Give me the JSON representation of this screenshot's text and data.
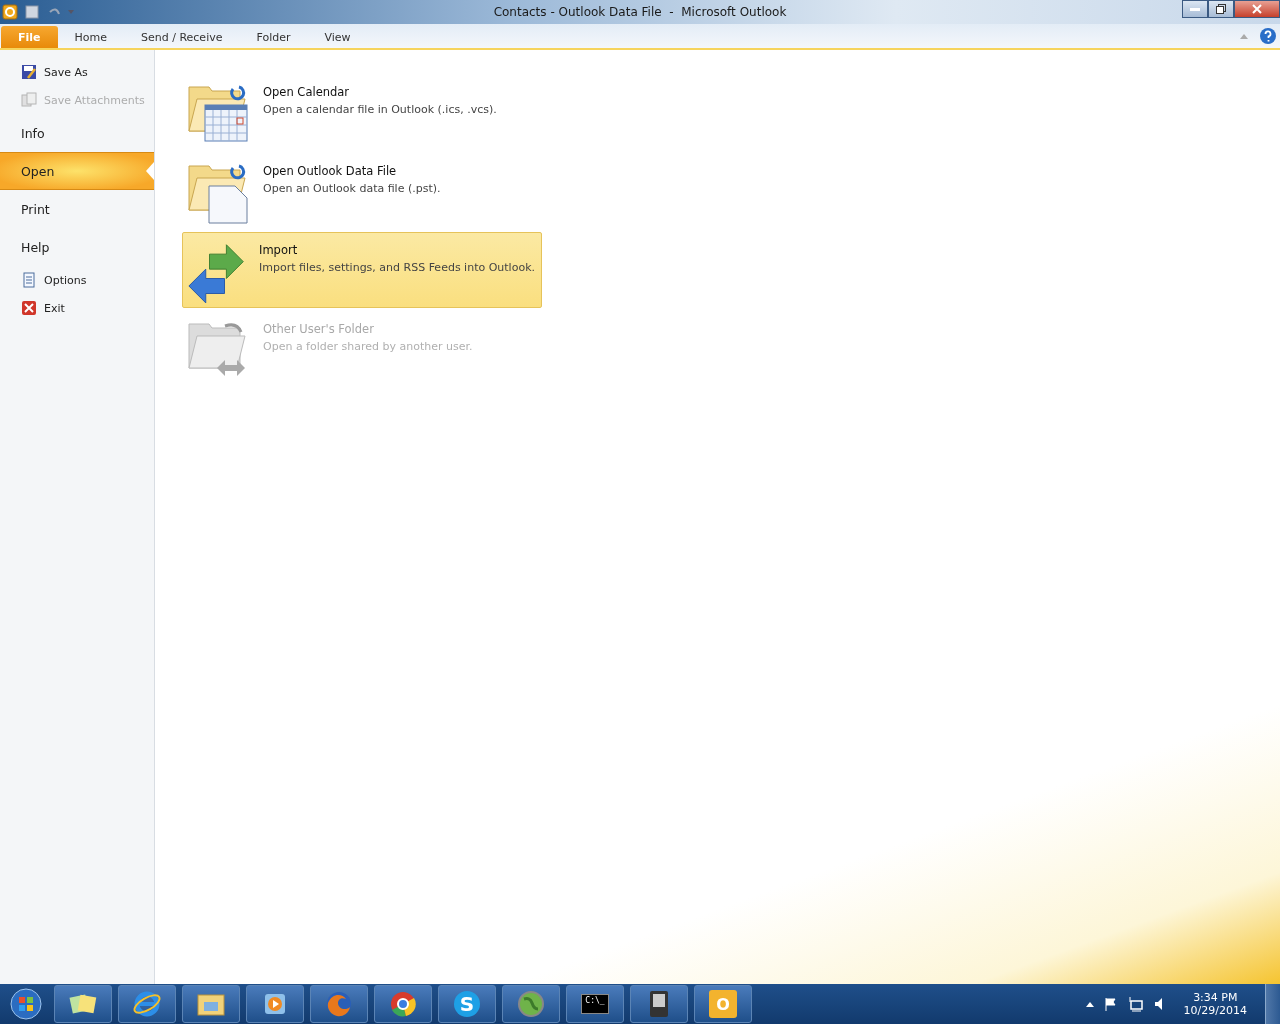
{
  "window": {
    "title": "Contacts - Outlook Data File  -  Microsoft Outlook"
  },
  "ribbon_tabs": [
    {
      "label": "File",
      "selected": true
    },
    {
      "label": "Home",
      "selected": false
    },
    {
      "label": "Send / Receive",
      "selected": false
    },
    {
      "label": "Folder",
      "selected": false
    },
    {
      "label": "View",
      "selected": false
    }
  ],
  "sidebar": {
    "items": [
      {
        "kind": "saveas",
        "label": "Save As",
        "disabled": false
      },
      {
        "kind": "attachments",
        "label": "Save Attachments",
        "disabled": true
      },
      {
        "kind": "section",
        "label": "Info",
        "selected": false
      },
      {
        "kind": "section",
        "label": "Open",
        "selected": true
      },
      {
        "kind": "section",
        "label": "Print",
        "selected": false
      },
      {
        "kind": "section",
        "label": "Help",
        "selected": false
      },
      {
        "kind": "options",
        "label": "Options",
        "disabled": false
      },
      {
        "kind": "exit",
        "label": "Exit",
        "disabled": false
      }
    ]
  },
  "open_options": [
    {
      "kind": "calendar",
      "title": "Open Calendar",
      "description": "Open a calendar file in Outlook (.ics, .vcs).",
      "disabled": false,
      "selected": false
    },
    {
      "kind": "datafile",
      "title": "Open Outlook Data File",
      "description": "Open an Outlook data file (.pst).",
      "disabled": false,
      "selected": false
    },
    {
      "kind": "import",
      "title": "Import",
      "description": "Import files, settings, and RSS Feeds into Outlook.",
      "disabled": false,
      "selected": true
    },
    {
      "kind": "shared",
      "title": "Other User's Folder",
      "description": "Open a folder shared by another user.",
      "disabled": true,
      "selected": false
    }
  ],
  "taskbar": {
    "apps": [
      {
        "kind": "notes"
      },
      {
        "kind": "ie"
      },
      {
        "kind": "explorer"
      },
      {
        "kind": "media"
      },
      {
        "kind": "firefox"
      },
      {
        "kind": "chrome"
      },
      {
        "kind": "skype",
        "glyph": "S"
      },
      {
        "kind": "globe"
      },
      {
        "kind": "console",
        "glyph": "C:\\_"
      },
      {
        "kind": "device"
      },
      {
        "kind": "outlook",
        "glyph": "O"
      }
    ],
    "time": "3:34 PM",
    "date": "10/29/2014"
  }
}
